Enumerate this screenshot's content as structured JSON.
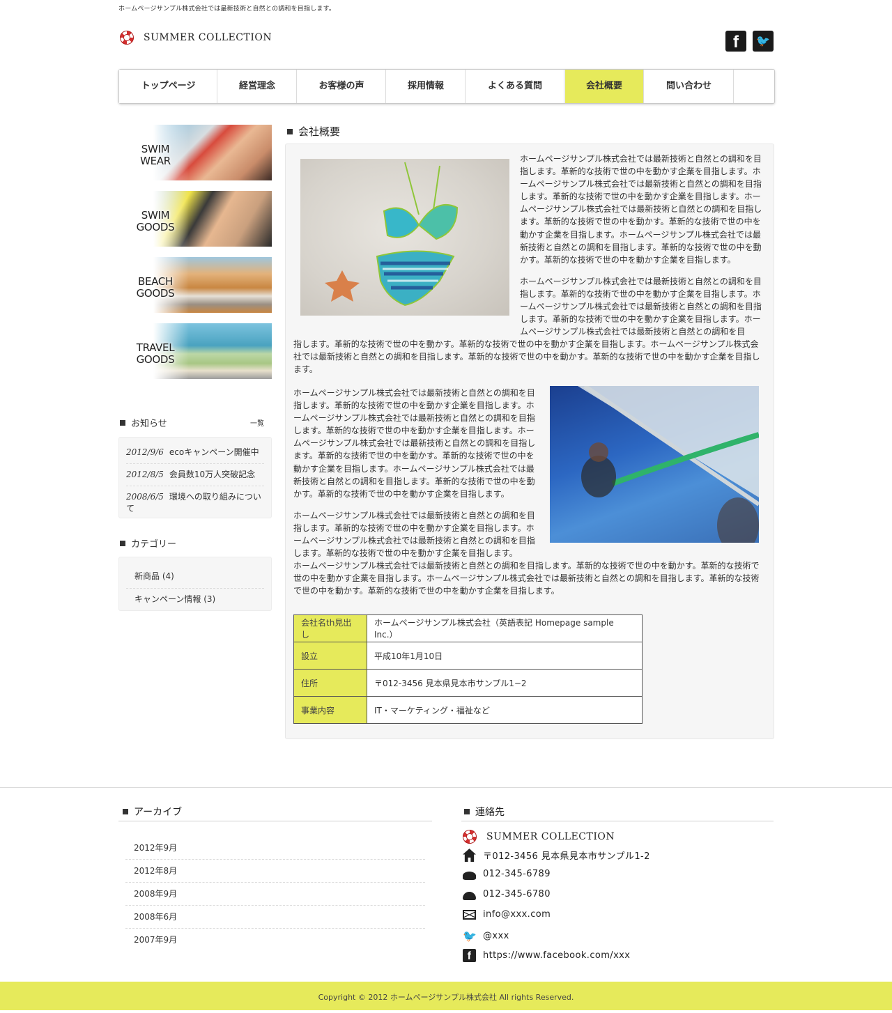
{
  "header": {
    "tagline": "ホームページサンプル株式会社では最新技術と自然との調和を目指します。",
    "logo_text": "SUMMER COLLECTION",
    "facebook_glyph": "f",
    "twitter_glyph": "🐦"
  },
  "nav": {
    "items": [
      {
        "label": "トップページ"
      },
      {
        "label": "経営理念"
      },
      {
        "label": "お客様の声"
      },
      {
        "label": "採用情報"
      },
      {
        "label": "よくある質問"
      },
      {
        "label": "会社概要"
      },
      {
        "label": "問い合わせ"
      }
    ],
    "active_index": 5,
    "active_color": "#e6ea5b"
  },
  "sidebar": {
    "banners": [
      {
        "label": "SWIM\nWEAR"
      },
      {
        "label": "SWIM\nGOODS"
      },
      {
        "label": "BEACH\nGOODS"
      },
      {
        "label": "TRAVEL\nGOODS"
      }
    ],
    "news": {
      "heading": "お知らせ",
      "more_label": "一覧",
      "items": [
        {
          "date": "2012/9/6",
          "text": "ecoキャンペーン開催中"
        },
        {
          "date": "2012/8/5",
          "text": "会員数10万人突破記念"
        },
        {
          "date": "2008/6/5",
          "text": "環境への取り組みについて"
        }
      ]
    },
    "categories": {
      "heading": "カテゴリー",
      "items": [
        {
          "label": "新商品 (4)"
        },
        {
          "label": "キャンペーン情報 (3)"
        }
      ]
    }
  },
  "main": {
    "heading": "会社概要",
    "para1": "ホームページサンプル株式会社では最新技術と自然との調和を目指します。革新的な技術で世の中を動かす企業を目指します。ホームページサンプル株式会社では最新技術と自然との調和を目指します。革新的な技術で世の中を動かす企業を目指します。ホームページサンプル株式会社では最新技術と自然との調和を目指します。革新的な技術で世の中を動かす。革新的な技術で世の中を動かす企業を目指します。ホームページサンプル株式会社では最新技術と自然との調和を目指します。革新的な技術で世の中を動かす。革新的な技術で世の中を動かす企業を目指します。",
    "para2a": "ホームページサンプル株式会社では最新技術と自然との調和を目指します。革新的な技術で世の中を動かす企業を目指します。ホームページサンプル株式会社では最新技術と自然との調和を目指します。革新的な技術で世の中を動かす企業を目指します。ホームページサンプル株式会社では最新技術と自然との調和を目",
    "para2b": "指します。革新的な技術で世の中を動かす。革新的な技術で世の中を動かす企業を目指します。ホームページサンプル株式会社では最新技術と自然との調和を目指します。革新的な技術で世の中を動かす。革新的な技術で世の中を動かす企業を目指します。",
    "para3": "ホームページサンプル株式会社では最新技術と自然との調和を目指します。革新的な技術で世の中を動かす企業を目指します。ホームページサンプル株式会社では最新技術と自然との調和を目指します。革新的な技術で世の中を動かす企業を目指します。ホームページサンプル株式会社では最新技術と自然との調和を目指します。革新的な技術で世の中を動かす。革新的な技術で世の中を動かす企業を目指します。ホームページサンプル株式会社では最新技術と自然との調和を目指します。革新的な技術で世の中を動かす。革新的な技術で世の中を動かす企業を目指します。",
    "para4a": "ホームページサンプル株式会社では最新技術と自然との調和を目指します。革新的な技術で世の中を動かす企業を目指します。ホームページサンプル株式会社では最新技術と自然との調和を目指します。革新的な技術で世の中を動かす企業を目指します。",
    "para4b": "ホームページサンプル株式会社では最新技術と自然との調和を目指します。革新的な技術で世の中を動かす。革新的な技術で世の中を動かす企業を目指します。ホームページサンプル株式会社では最新技術と自然との調和を目指します。革新的な技術で世の中を動かす。革新的な技術で世の中を動かす企業を目指します。",
    "table": {
      "rows": [
        {
          "th": "会社名th見出し",
          "td": "ホームページサンプル株式会社（英語表記 Homepage sample Inc.）"
        },
        {
          "th": "設立",
          "td": "平成10年1月10日"
        },
        {
          "th": "住所",
          "td": "〒012-3456 見本県見本市サンプル1−2"
        },
        {
          "th": "事業内容",
          "td": "IT・マーケティング・福祉など"
        }
      ]
    }
  },
  "footer": {
    "archive_heading": "アーカイブ",
    "archives": [
      {
        "label": "2012年9月"
      },
      {
        "label": "2012年8月"
      },
      {
        "label": "2008年9月"
      },
      {
        "label": "2008年6月"
      },
      {
        "label": "2007年9月"
      }
    ],
    "contact_heading": "連絡先",
    "company": "SUMMER COLLECTION",
    "address": "〒012-3456 見本県見本市サンプル1-2",
    "tel": "012-345-6789",
    "fax": "012-345-6780",
    "email": "info@xxx.com",
    "twitter": "@xxx",
    "facebook": "https://www.facebook.com/xxx",
    "copyright": "Copyright © 2012 ホームページサンプル株式会社 All rights Reserved."
  }
}
